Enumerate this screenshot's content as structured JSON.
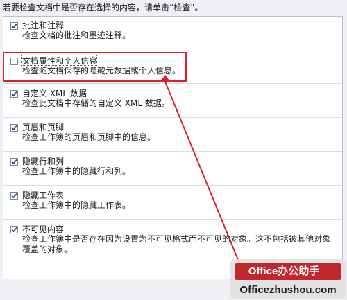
{
  "dialog": {
    "instruction": "若要检查文档中是否存在选择的内容，请单击“检查”。",
    "items": [
      {
        "title": "批注和注释",
        "description": "检查文档的批注和墨迹注释。",
        "checked": true
      },
      {
        "title": "文档属性和个人信息",
        "description": "检查随文档保存的隐藏元数据或个人信息。",
        "checked": false
      },
      {
        "title": "自定义 XML 数据",
        "description": "检查此文档中存储的自定义 XML 数据。",
        "checked": true
      },
      {
        "title": "页眉和页脚",
        "description": "检查工作簿的页眉和页脚中的信息。",
        "checked": true
      },
      {
        "title": "隐藏行和列",
        "description": "检查工作簿中的隐藏行和列。",
        "checked": true
      },
      {
        "title": "隐藏工作表",
        "description": "检查工作簿中的隐藏工作表。",
        "checked": true
      },
      {
        "title": "不可见内容",
        "description": "检查工作簿中是否存在因为设置为不可见格式而不可见的对象。这不包括被其他对象覆盖的对象。",
        "checked": true
      }
    ]
  },
  "watermark": {
    "brand": "Office办公助手",
    "site": "Officezhushou.com"
  },
  "colors": {
    "highlight": "#d8232a",
    "checkbox_border": "#7a8a9c",
    "check_mark": "#1e3f8a",
    "logo_red": "#c2272d"
  }
}
